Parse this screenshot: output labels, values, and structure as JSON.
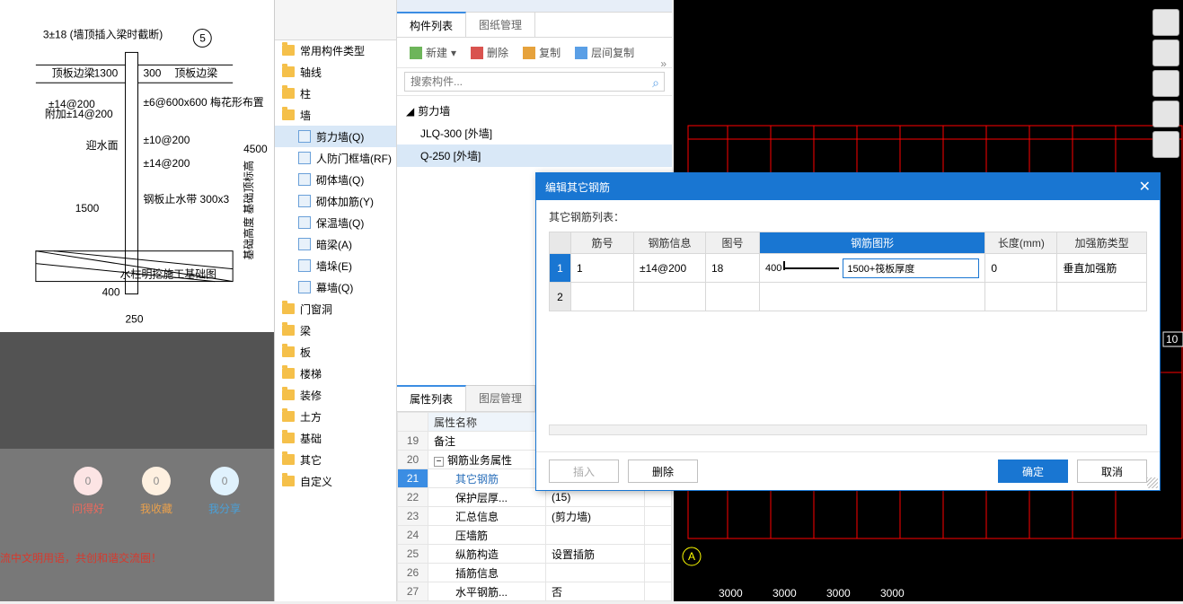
{
  "drawing": {
    "topNote": "3±18 (墙顶插入梁时截断)",
    "circleNum": "5",
    "labels": {
      "topbeamL": "顶板边梁",
      "dim1300L": "1300",
      "dim300R": "300",
      "topbeamR": "顶板边梁",
      "a14_200": "±14@200",
      "a14_200b": "附加±14@200",
      "meihua": "±6@600x600\n梅花形布置",
      "a10_200": "±10@200",
      "a14_200c": "±14@200",
      "side": "迎水面",
      "v1500": "1500",
      "v4500": "4500",
      "stop": "钢板止水带\n300x3",
      "base": "水柱明挖施工基础图",
      "w400": "400",
      "w250": "250",
      "jichu": "基础高度 基础顶标高"
    }
  },
  "social": {
    "countRed": "0",
    "countOrange": "0",
    "countBlue": "0",
    "labelRed": "问得好",
    "labelOrange": "我收藏",
    "labelBlue": "我分享",
    "footer": "流中文明用语，共创和谐交流圈！"
  },
  "tree": {
    "items": [
      {
        "label": "常用构件类型",
        "type": "folder"
      },
      {
        "label": "轴线",
        "type": "folder"
      },
      {
        "label": "柱",
        "type": "folder"
      },
      {
        "label": "墙",
        "type": "folder",
        "expanded": true,
        "children": [
          {
            "label": "剪力墙(Q)",
            "selected": true
          },
          {
            "label": "人防门框墙(RF)"
          },
          {
            "label": "砌体墙(Q)"
          },
          {
            "label": "砌体加筋(Y)"
          },
          {
            "label": "保温墙(Q)"
          },
          {
            "label": "暗梁(A)"
          },
          {
            "label": "墙垛(E)"
          },
          {
            "label": "幕墙(Q)"
          }
        ]
      },
      {
        "label": "门窗洞",
        "type": "folder"
      },
      {
        "label": "梁",
        "type": "folder"
      },
      {
        "label": "板",
        "type": "folder"
      },
      {
        "label": "楼梯",
        "type": "folder"
      },
      {
        "label": "装修",
        "type": "folder"
      },
      {
        "label": "土方",
        "type": "folder"
      },
      {
        "label": "基础",
        "type": "folder"
      },
      {
        "label": "其它",
        "type": "folder"
      },
      {
        "label": "自定义",
        "type": "folder"
      }
    ]
  },
  "compTabs": {
    "t1": "构件列表",
    "t2": "图纸管理"
  },
  "compToolbar": {
    "new": "新建",
    "del": "删除",
    "copy": "复制",
    "layerCopy": "层间复制"
  },
  "search": {
    "placeholder": "搜索构件..."
  },
  "compTree": {
    "root": "剪力墙",
    "i1": "JLQ-300 [外墙]",
    "i2": "Q-250 [外墙]"
  },
  "propsTabs": {
    "t1": "属性列表",
    "t2": "图层管理"
  },
  "props": {
    "nameHdr": "属性名称",
    "rows": [
      {
        "n": "19",
        "name": "备注",
        "val": ""
      },
      {
        "n": "20",
        "name": "钢筋业务属性",
        "val": "",
        "exp": "-"
      },
      {
        "n": "21",
        "name": "其它钢筋",
        "val": "",
        "sel": true,
        "indent": true,
        "dots": true
      },
      {
        "n": "22",
        "name": "保护层厚...",
        "val": "(15)",
        "indent": true
      },
      {
        "n": "23",
        "name": "汇总信息",
        "val": "(剪力墙)",
        "indent": true
      },
      {
        "n": "24",
        "name": "压墙筋",
        "val": "",
        "indent": true
      },
      {
        "n": "25",
        "name": "纵筋构造",
        "val": "设置插筋",
        "indent": true
      },
      {
        "n": "26",
        "name": "插筋信息",
        "val": "",
        "indent": true
      },
      {
        "n": "27",
        "name": "水平钢筋...",
        "val": "否",
        "indent": true
      }
    ]
  },
  "cad": {
    "axisA": "A",
    "d3000": "3000",
    "d10": "10"
  },
  "dialog": {
    "title": "编辑其它钢筋",
    "subtitle": "其它钢筋列表：",
    "headers": {
      "h1": "筋号",
      "h2": "钢筋信息",
      "h3": "图号",
      "h4": "钢筋图形",
      "h5": "长度(mm)",
      "h6": "加强筋类型"
    },
    "row1": {
      "num": "1",
      "jh": "1",
      "info": "±14@200",
      "th": "18",
      "shapeLeft": "400",
      "shapeInput": "1500+筏板厚度",
      "len": "0",
      "type": "垂直加强筋"
    },
    "row2": {
      "num": "2"
    },
    "buttons": {
      "insert": "插入",
      "delete": "删除",
      "ok": "确定",
      "cancel": "取消"
    }
  }
}
